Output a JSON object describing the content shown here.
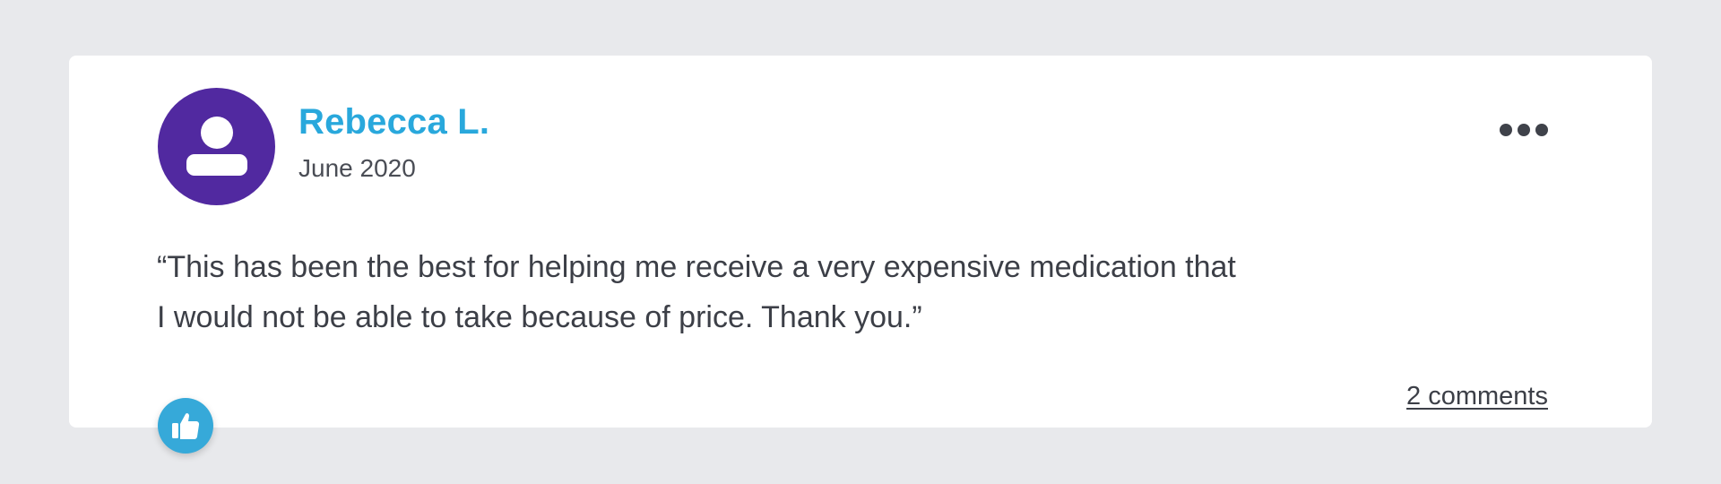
{
  "review": {
    "author": "Rebecca L.",
    "date": "June 2020",
    "text_line1": "“This has been the best for helping me receive a very expensive medication that",
    "text_line2": "I would not be able to take because of price. Thank you.”",
    "comments_label": "2 comments"
  },
  "icons": {
    "avatar": "user-icon",
    "menu": "more-horizontal-icon",
    "like": "thumbs-up-icon"
  },
  "colors": {
    "background": "#e8e9ec",
    "card": "#ffffff",
    "avatar": "#5129a0",
    "author": "#29a8dc",
    "text": "#3c3f47",
    "like_button": "#36a9d9"
  }
}
